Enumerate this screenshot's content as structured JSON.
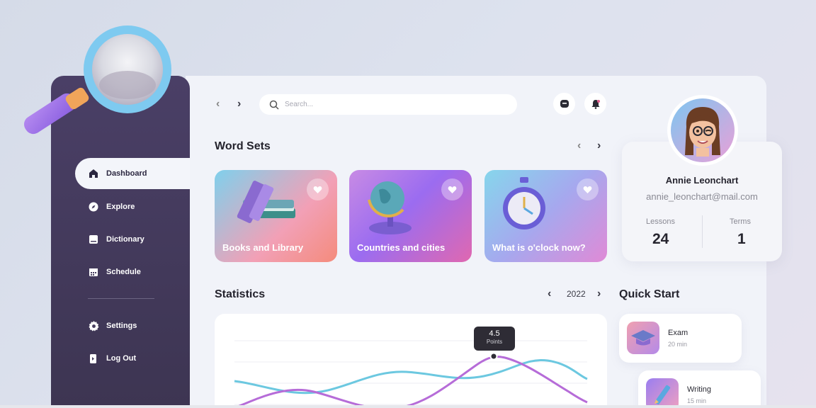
{
  "search": {
    "placeholder": "Search..."
  },
  "sidebar": {
    "items": [
      {
        "label": "Dashboard",
        "icon": "home-icon",
        "active": true
      },
      {
        "label": "Explore",
        "icon": "compass-icon",
        "active": false
      },
      {
        "label": "Dictionary",
        "icon": "book-icon",
        "active": false
      },
      {
        "label": "Schedule",
        "icon": "calendar-icon",
        "active": false
      }
    ],
    "bottom_items": [
      {
        "label": "Settings",
        "icon": "gear-icon"
      },
      {
        "label": "Log Out",
        "icon": "logout-icon"
      }
    ]
  },
  "word_sets": {
    "title": "Word Sets",
    "cards": [
      {
        "label": "Books and Library",
        "icon": "books-icon"
      },
      {
        "label": "Countries and cities",
        "icon": "globe-icon"
      },
      {
        "label": "What is o'clock now?",
        "icon": "stopwatch-icon"
      }
    ]
  },
  "profile": {
    "name": "Annie Leonchart",
    "email": "annie_leonchart@mail.com",
    "lessons_label": "Lessons",
    "lessons_value": "24",
    "terms_label": "Terms",
    "terms_value": "1"
  },
  "statistics": {
    "title": "Statistics",
    "year": "2022",
    "tooltip_value": "4.5",
    "tooltip_label": "Points"
  },
  "quick_start": {
    "title": "Quick Start",
    "items": [
      {
        "title": "Exam",
        "duration": "20 min",
        "icon": "graduation-cap-icon"
      },
      {
        "title": "Writing",
        "duration": "15 min",
        "icon": "pencil-icon"
      }
    ]
  },
  "colors": {
    "sidebar": "#463d5e",
    "chart_purple": "#b66cd8",
    "chart_cyan": "#6cc8e0"
  }
}
